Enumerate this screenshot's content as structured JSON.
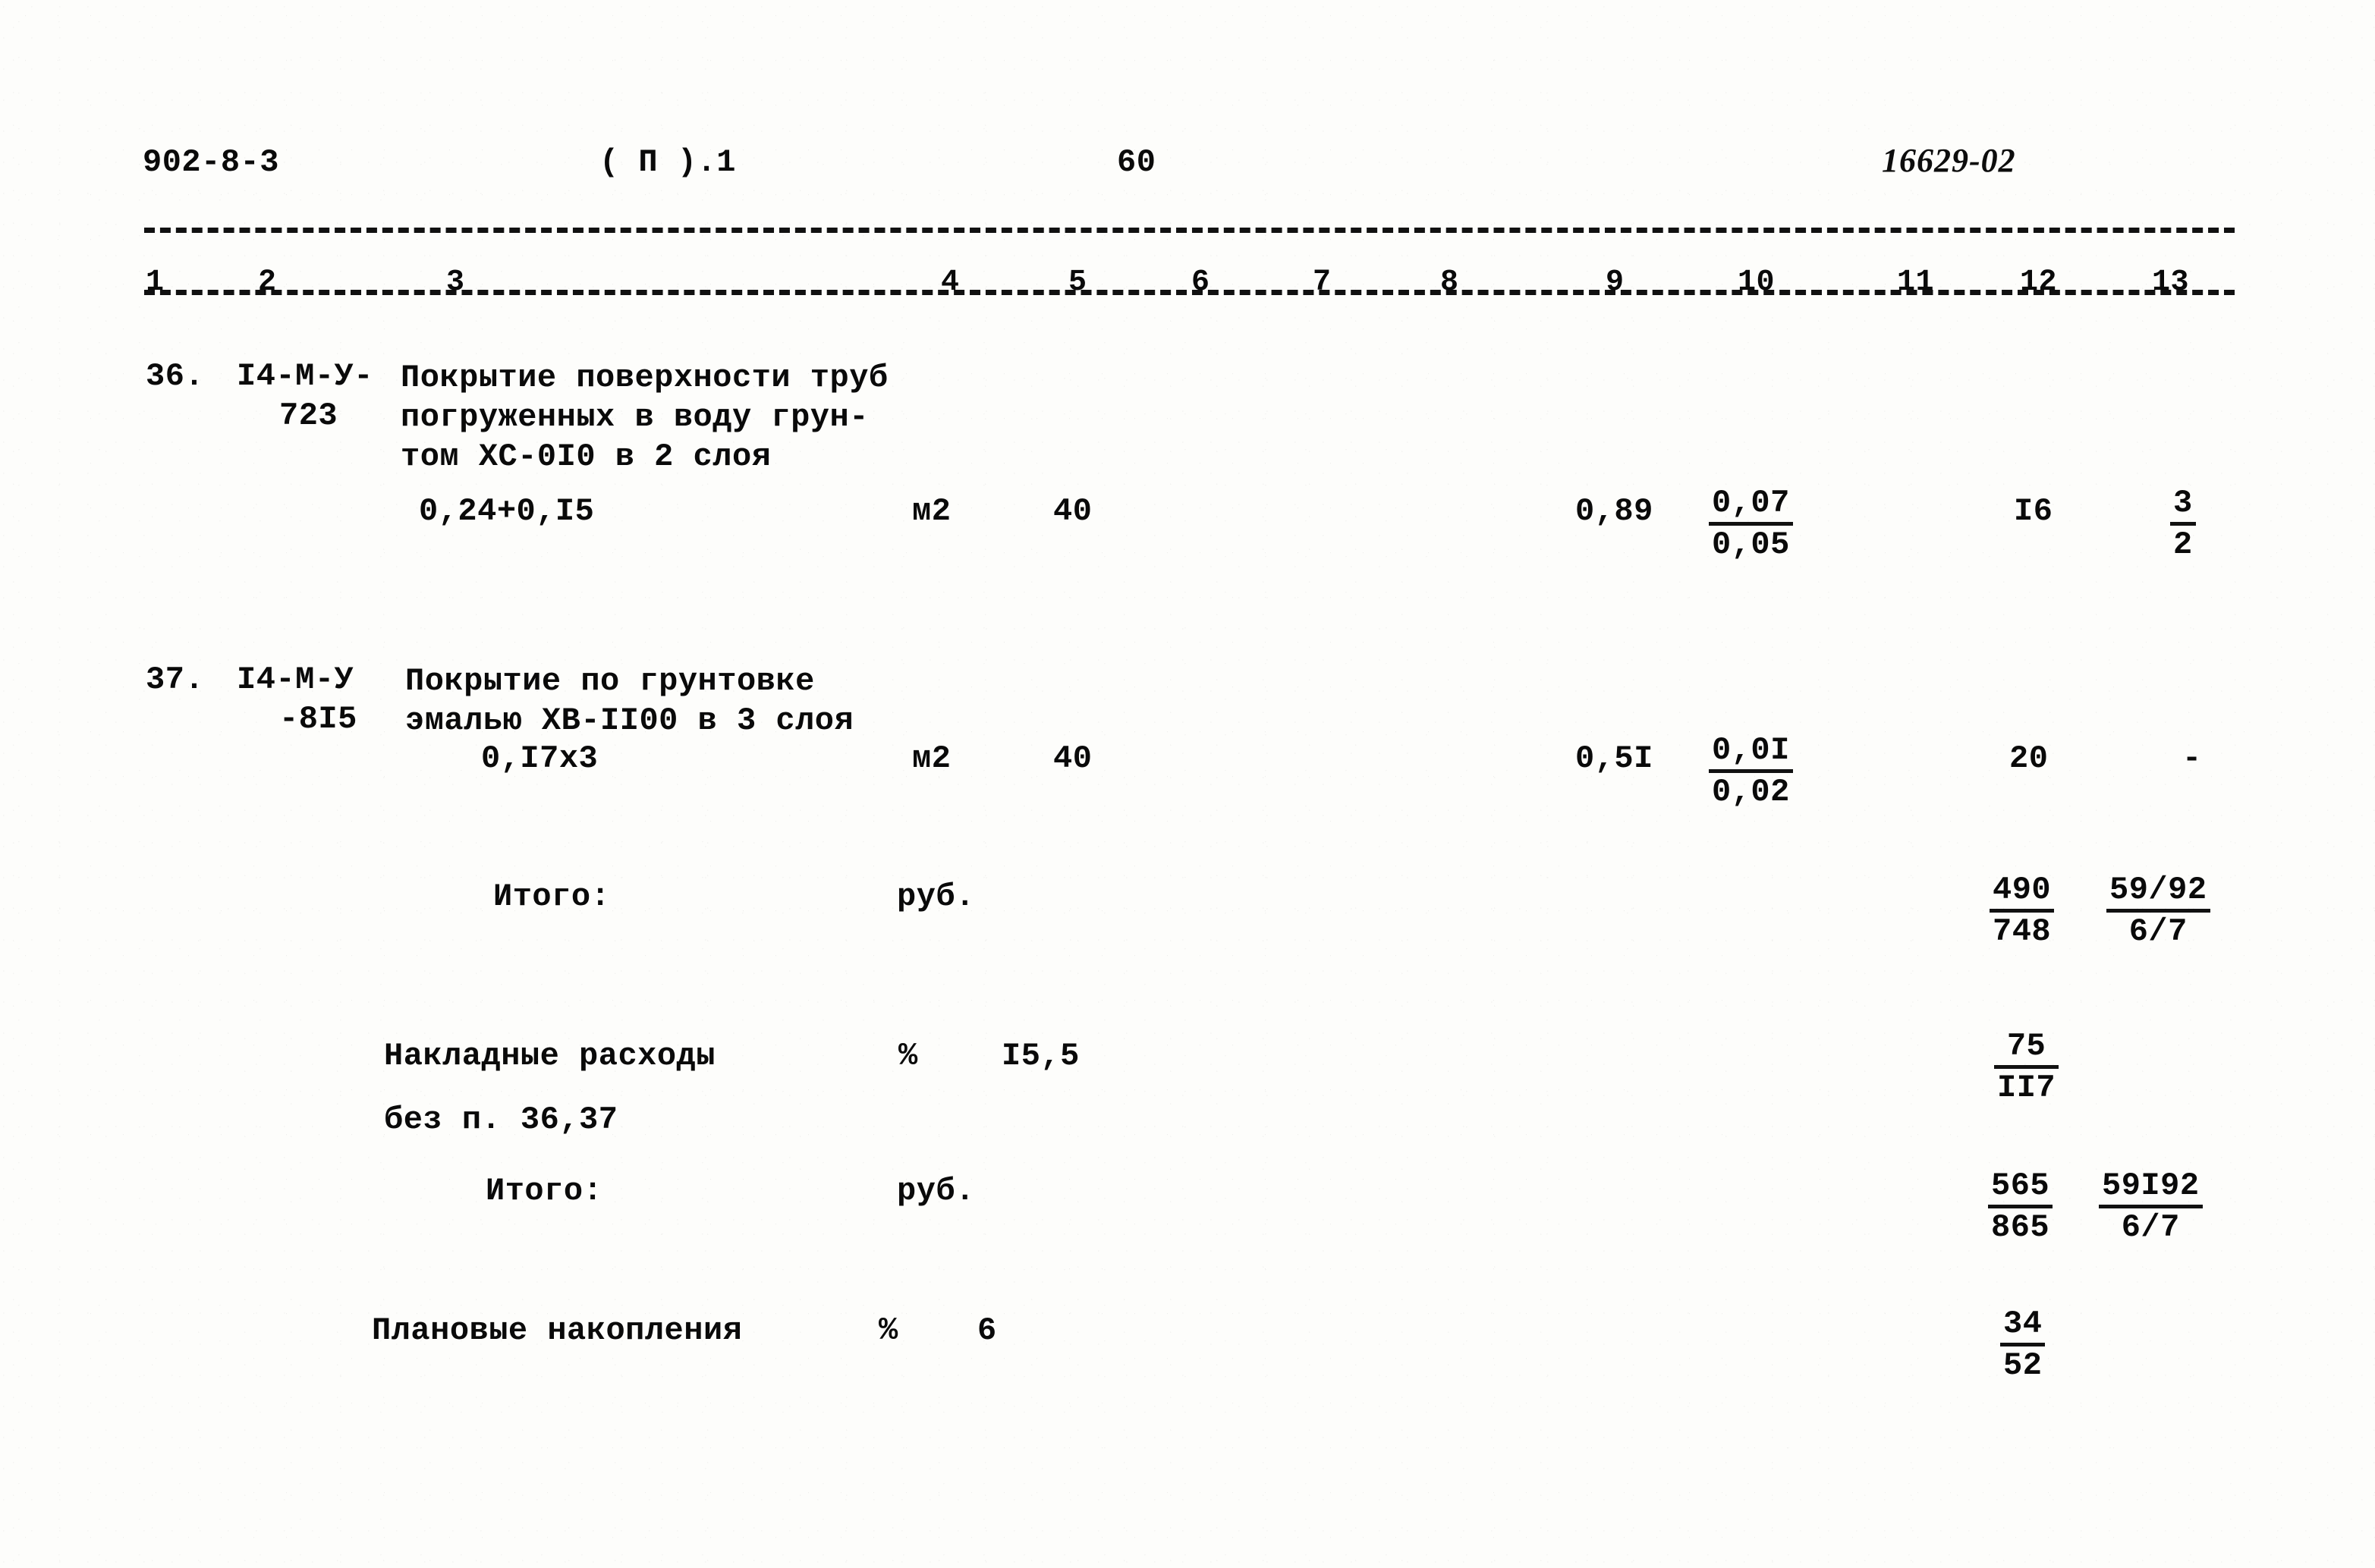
{
  "document": {
    "sheet_code": "902-8-3",
    "part_label": "( П ).1",
    "page_number": "60",
    "doc_number": "16629-02"
  },
  "column_numbers": [
    "1",
    "2",
    "3",
    "4",
    "5",
    "6",
    "7",
    "8",
    "9",
    "10",
    "11",
    "12",
    "13"
  ],
  "rows": [
    {
      "number": "36.",
      "code_line1": "I4-М-У-",
      "code_line2": "723",
      "description_line1": "Покрытие поверхности труб",
      "description_line2": "погруженных в воду грун-",
      "description_line3": "том ХС-0I0 в 2 слоя",
      "quantity_formula": "0,24+0,I5",
      "unit": "м2",
      "col5": "40",
      "col9": "0,89",
      "col10_num": "0,07",
      "col10_den": "0,05",
      "col11": "I6",
      "col12_num": "3",
      "col12_den": "2"
    },
    {
      "number": "37.",
      "code_line1": "I4-М-У",
      "code_line2": "-8I5",
      "description_line1": "Покрытие по грунтовке",
      "description_line2": "эмалью ХВ-II00 в 3 слоя",
      "quantity_formula": "0,I7х3",
      "unit": "м2",
      "col5": "40",
      "col9": "0,5I",
      "col10_num": "0,0I",
      "col10_den": "0,02",
      "col11": "20",
      "col12": "-"
    }
  ],
  "totals": [
    {
      "label": "Итого:",
      "unit": "руб.",
      "col11_num": "490",
      "col11_den": "748",
      "col12_num": "59/92",
      "col12_den": "6/7"
    },
    {
      "label": "Накладные расходы",
      "label_line2": "без п. 36,37",
      "percent_sign": "%",
      "percent_value": "I5,5",
      "col11_num": "75",
      "col11_den": "II7"
    },
    {
      "label": "Итого:",
      "unit": "руб.",
      "col11_num": "565",
      "col11_den": "865",
      "col12_num": "59I92",
      "col12_den": "6/7"
    },
    {
      "label": "Плановые накопления",
      "percent_sign": "%",
      "percent_value": "6",
      "col11_num": "34",
      "col11_den": "52"
    }
  ]
}
